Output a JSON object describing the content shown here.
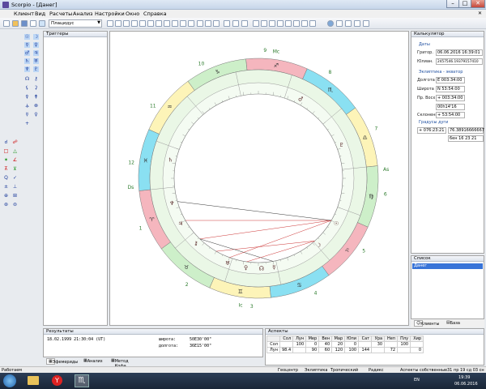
{
  "window": {
    "title": "Scorpio - [Данег]"
  },
  "menu": [
    "Клиент",
    "Вид",
    "Расчеты",
    "Анализ",
    "Настройки",
    "Окно",
    "Справка"
  ],
  "toolbar": {
    "house_system": "Плацидус"
  },
  "triggers": {
    "title": "Триггеры"
  },
  "chart": {
    "house_numbers": [
      "1",
      "2",
      "3",
      "4",
      "5",
      "6",
      "7",
      "8",
      "9",
      "10",
      "11",
      "12"
    ],
    "labels": {
      "asc": "As",
      "mc": "Mc",
      "ic": "Ic",
      "dsc": "Ds"
    }
  },
  "calculator": {
    "title": "Калькулятор",
    "dates_title": "Даты",
    "gregorian_label": "Григор.",
    "gregorian_value": "06.06.2016 16:39:01",
    "julian_label": "Юлиан.",
    "julian_value": "2457546.19379157410",
    "ecliptic_title": "Эклиптика - экватор",
    "longitude_label": "Долгота",
    "longitude_value": "E 003:34:00",
    "latitude_label": "Широта",
    "latitude_value": "N 53:54:00",
    "ra_label": "Пр. Восх",
    "ra_value": "+ 003:34:00",
    "ra_time": "00h14'16",
    "decl_label": "Склонение",
    "decl_value": "+ 53:54:00",
    "degree_title": "Градусы дуги",
    "degree_value": "+ 076:23:21",
    "degree_decimal": "76.38916666667",
    "degree_b": "6ен 16 23 21"
  },
  "list": {
    "title": "Список",
    "items": [
      "Данег"
    ]
  },
  "side_tabs": [
    "Клиенты",
    "База"
  ],
  "results": {
    "title": "Результаты",
    "line1_date": "18.02.1999 21:30:04 (UT)",
    "line1_label": "широта:",
    "line1_value": "50E30'00\"",
    "line2_label": "долгота:",
    "line2_value": "36E15'00\""
  },
  "result_tabs": [
    "Эфемериды",
    "Анализ",
    "Метод Кофа"
  ],
  "aspects": {
    "title": "Аспекты",
    "headers": [
      "",
      "Сол",
      "Лун",
      "Мер",
      "Вен",
      "Мар",
      "Юпи",
      "Сат",
      "Ура",
      "Неп",
      "Плу",
      "Хир"
    ],
    "rows": [
      [
        "Сол",
        "",
        "100",
        "0",
        "40",
        "20",
        "0",
        "",
        "30",
        "",
        "100",
        ""
      ],
      [
        "Лун",
        "98.4",
        "",
        "90",
        "60",
        "120",
        "100",
        "144",
        "",
        "72",
        "",
        "0"
      ]
    ]
  },
  "status": {
    "left": "Работаем",
    "items": [
      "Геоцентр",
      "Эклиптика",
      "Тропический",
      "Радикс",
      "Аспекты собственные",
      "31 пр 19 сд 03 сн"
    ]
  },
  "taskbar": {
    "lang": "EN",
    "time": "19:39",
    "date": "06.06.2016"
  },
  "colors": {
    "fire": "#f5b6be",
    "earth": "#cdefc9",
    "air": "#fdf4b8",
    "water": "#8ae0f2"
  }
}
